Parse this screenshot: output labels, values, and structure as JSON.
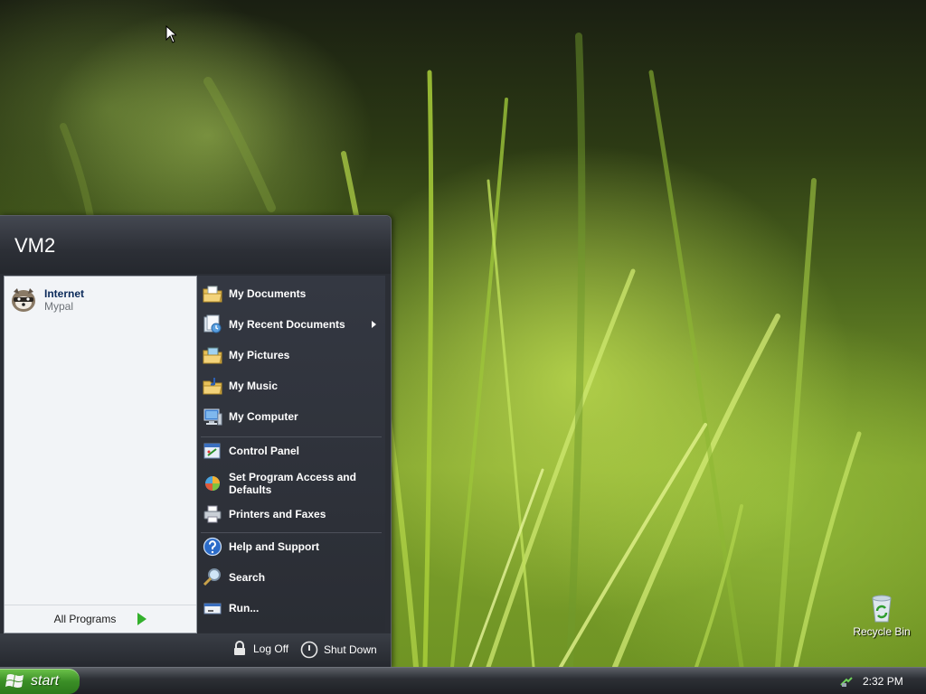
{
  "start_menu": {
    "user_name": "VM2",
    "pinned": {
      "title": "Internet",
      "subtitle": "Mypal"
    },
    "all_programs_label": "All Programs",
    "right_items": [
      {
        "label": "My Documents",
        "icon": "folder-documents-icon"
      },
      {
        "label": "My Recent Documents",
        "icon": "recent-documents-icon",
        "submenu": true
      },
      {
        "label": "My Pictures",
        "icon": "folder-pictures-icon"
      },
      {
        "label": "My Music",
        "icon": "folder-music-icon"
      },
      {
        "label": "My Computer",
        "icon": "computer-icon"
      },
      {
        "label": "Control Panel",
        "icon": "control-panel-icon"
      },
      {
        "label": "Set Program Access and Defaults",
        "icon": "program-access-icon"
      },
      {
        "label": "Printers and Faxes",
        "icon": "printer-icon"
      },
      {
        "label": "Help and Support",
        "icon": "help-icon"
      },
      {
        "label": "Search",
        "icon": "search-icon"
      },
      {
        "label": "Run...",
        "icon": "run-icon"
      }
    ],
    "log_off_label": "Log Off",
    "shut_down_label": "Shut Down"
  },
  "desktop": {
    "recycle_bin_label": "Recycle Bin"
  },
  "taskbar": {
    "start_label": "start",
    "clock": "2:32 PM"
  }
}
